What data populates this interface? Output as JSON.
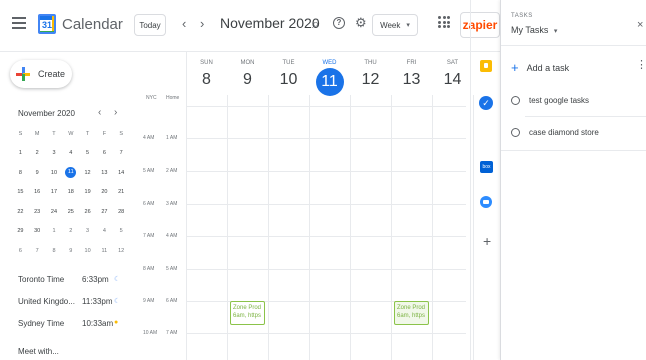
{
  "header": {
    "app_title": "Calendar",
    "logo_day": "31",
    "today_label": "Today",
    "prev_glyph": "‹",
    "next_glyph": "›",
    "month_title": "November 2020",
    "view_label": "Week",
    "view_caret": "▾",
    "zapier_label": "zapier",
    "search_icon": "⌕",
    "help_icon": "?",
    "settings_icon": "⚙"
  },
  "create_label": "Create",
  "mini_calendar": {
    "title": "November 2020",
    "weekdays": [
      "S",
      "M",
      "T",
      "W",
      "T",
      "F",
      "S"
    ],
    "weeks": [
      [
        "1",
        "2",
        "3",
        "4",
        "5",
        "6",
        "7"
      ],
      [
        "8",
        "9",
        "10",
        "11",
        "12",
        "13",
        "14"
      ],
      [
        "15",
        "16",
        "17",
        "18",
        "19",
        "20",
        "21"
      ],
      [
        "22",
        "23",
        "24",
        "25",
        "26",
        "27",
        "28"
      ],
      [
        "29",
        "30",
        "1",
        "2",
        "3",
        "4",
        "5"
      ],
      [
        "6",
        "7",
        "8",
        "9",
        "10",
        "11",
        "12"
      ]
    ],
    "selected": "11"
  },
  "timezones": [
    {
      "name": "Toronto Time",
      "time": "6:33pm",
      "icon": "moon-icon",
      "glyph": "☾",
      "color": "#8ab4f8"
    },
    {
      "name": "United Kingdo...",
      "time": "11:33pm",
      "icon": "moon-icon",
      "glyph": "☾",
      "color": "#8ab4f8"
    },
    {
      "name": "Sydney Time",
      "time": "10:33am",
      "icon": "sun-icon",
      "glyph": "●",
      "color": "#fbbc04"
    }
  ],
  "meet_label": "Meet with...",
  "grid": {
    "tz_primary": "NYC",
    "tz_secondary": "Home",
    "days": [
      {
        "dow": "SUN",
        "num": "8"
      },
      {
        "dow": "MON",
        "num": "9"
      },
      {
        "dow": "TUE",
        "num": "10"
      },
      {
        "dow": "WED",
        "num": "11",
        "current": true
      },
      {
        "dow": "THU",
        "num": "12"
      },
      {
        "dow": "FRI",
        "num": "13"
      },
      {
        "dow": "SAT",
        "num": "14"
      }
    ],
    "times": [
      {
        "a": "4 AM",
        "b": "1 AM"
      },
      {
        "a": "5 AM",
        "b": "2 AM"
      },
      {
        "a": "6 AM",
        "b": "3 AM"
      },
      {
        "a": "7 AM",
        "b": "4 AM"
      },
      {
        "a": "8 AM",
        "b": "5 AM"
      },
      {
        "a": "9 AM",
        "b": "6 AM"
      },
      {
        "a": "10 AM",
        "b": "7 AM"
      }
    ],
    "events": [
      {
        "line1": "Zone Prod",
        "line2": "6am, https"
      },
      {
        "line1": "Zone Prod",
        "line2": "6am, https"
      }
    ]
  },
  "tasks": {
    "label": "TASKS",
    "list_name": "My Tasks",
    "list_caret": "▾",
    "close_glyph": "×",
    "menu_glyph": "⋮",
    "add_label": "Add a task",
    "add_glyph": "+",
    "items": [
      "test google tasks",
      "case diamond store"
    ]
  },
  "side_panel": {
    "add_glyph": "+",
    "colors": {
      "keep": "#fbbc04",
      "tasks": "#1a73e8",
      "zoom": "#2d8cff",
      "box": "#0061d5"
    }
  }
}
